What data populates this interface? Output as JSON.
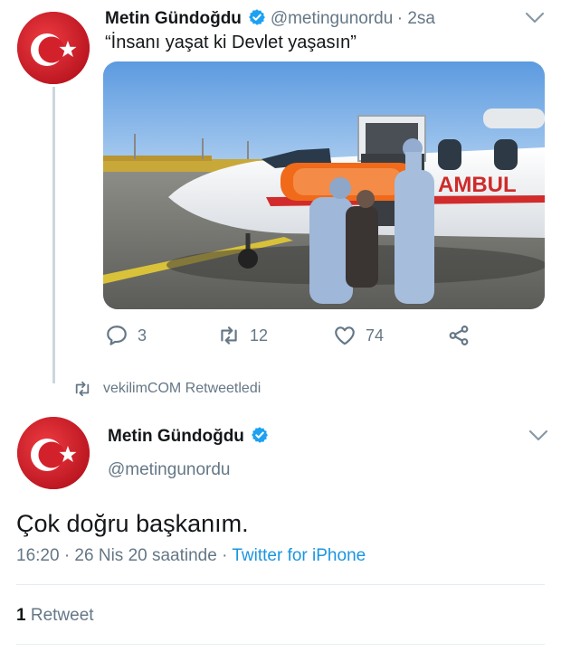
{
  "retweeted_tweet": {
    "author_name": "Metin Gündoğdu",
    "author_handle": "@metingunordu",
    "time_ago": "· 2sa",
    "text": "“İnsanı yaşat ki Devlet yaşasın”",
    "media_text": "AMBUL",
    "actions": {
      "reply_count": "3",
      "retweet_count": "12",
      "like_count": "74"
    }
  },
  "retweet_context": {
    "label": "vekilimCOM Retweetledi"
  },
  "main_tweet": {
    "author_name": "Metin Gündoğdu",
    "author_handle": "@metingunordu",
    "text": "Çok doğru başkanım.",
    "timestamp": "16:20 · 26 Nis 20 saatinde · ",
    "source": "Twitter for iPhone",
    "retweet_number": "1",
    "retweet_word": " Retweet"
  },
  "colors": {
    "accent": "#1b95e0",
    "verified": "#1da1f2",
    "flag_red": "#d81e2c",
    "secondary_text": "#657786"
  },
  "icons": [
    "avatar-flag",
    "verified-badge-icon",
    "chevron-down-icon",
    "reply-icon",
    "retweet-icon",
    "like-icon",
    "share-icon"
  ]
}
